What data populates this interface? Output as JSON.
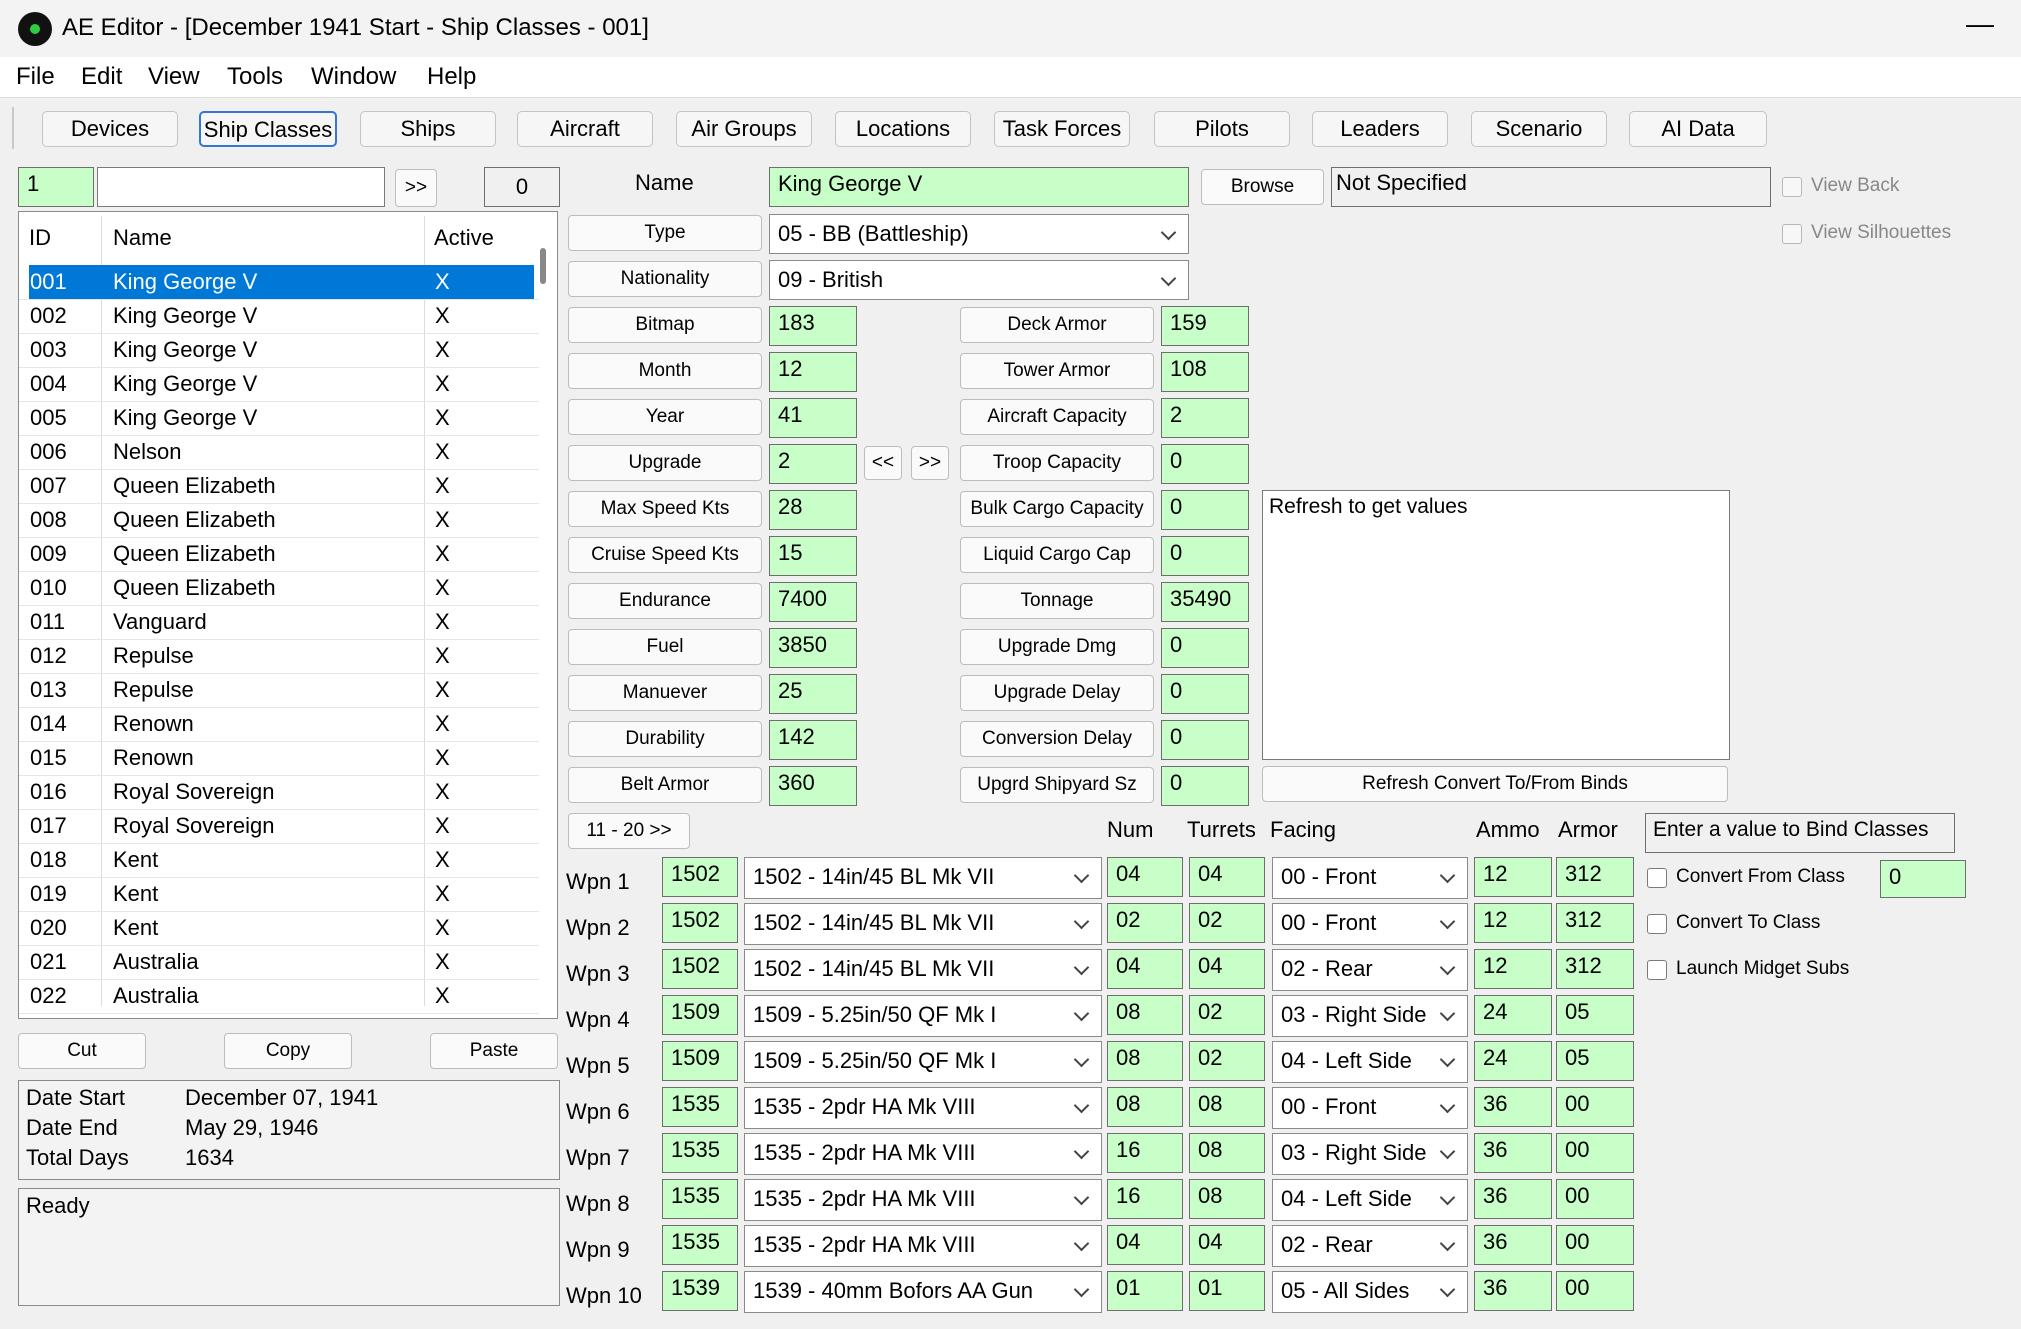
{
  "window": {
    "app": "AE Editor",
    "title": "AE Editor - [December 1941 Start - Ship Classes - 001]"
  },
  "menu": [
    "File",
    "Edit",
    "View",
    "Tools",
    "Window",
    "Help"
  ],
  "tabs": [
    "Devices",
    "Ship Classes",
    "Ships",
    "Aircraft",
    "Air Groups",
    "Locations",
    "Task Forces",
    "Pilots",
    "Leaders",
    "Scenario",
    "AI Data"
  ],
  "active_tab": "Ship Classes",
  "filter": {
    "id_value": "1",
    "search_value": "",
    "go_label": ">>",
    "count": "0"
  },
  "list": {
    "headers": {
      "id": "ID",
      "name": "Name",
      "active": "Active"
    },
    "rows": [
      {
        "id": "001",
        "name": "King George V",
        "active": "X"
      },
      {
        "id": "002",
        "name": "King George V",
        "active": "X"
      },
      {
        "id": "003",
        "name": "King George V",
        "active": "X"
      },
      {
        "id": "004",
        "name": "King George V",
        "active": "X"
      },
      {
        "id": "005",
        "name": "King George V",
        "active": "X"
      },
      {
        "id": "006",
        "name": "Nelson",
        "active": "X"
      },
      {
        "id": "007",
        "name": "Queen Elizabeth",
        "active": "X"
      },
      {
        "id": "008",
        "name": "Queen Elizabeth",
        "active": "X"
      },
      {
        "id": "009",
        "name": "Queen Elizabeth",
        "active": "X"
      },
      {
        "id": "010",
        "name": "Queen Elizabeth",
        "active": "X"
      },
      {
        "id": "011",
        "name": "Vanguard",
        "active": "X"
      },
      {
        "id": "012",
        "name": "Repulse",
        "active": "X"
      },
      {
        "id": "013",
        "name": "Repulse",
        "active": "X"
      },
      {
        "id": "014",
        "name": "Renown",
        "active": "X"
      },
      {
        "id": "015",
        "name": "Renown",
        "active": "X"
      },
      {
        "id": "016",
        "name": "Royal Sovereign",
        "active": "X"
      },
      {
        "id": "017",
        "name": "Royal Sovereign",
        "active": "X"
      },
      {
        "id": "018",
        "name": "Kent",
        "active": "X"
      },
      {
        "id": "019",
        "name": "Kent",
        "active": "X"
      },
      {
        "id": "020",
        "name": "Kent",
        "active": "X"
      },
      {
        "id": "021",
        "name": "Australia",
        "active": "X"
      },
      {
        "id": "022",
        "name": "Australia",
        "active": "X"
      }
    ]
  },
  "clipboard": {
    "cut": "Cut",
    "copy": "Copy",
    "paste": "Paste"
  },
  "dates": {
    "start_label": "Date Start",
    "start_value": "December 07, 1941",
    "end_label": "Date End",
    "end_value": "May 29, 1946",
    "days_label": "Total Days",
    "days_value": "1634"
  },
  "status": "Ready",
  "form": {
    "name_label": "Name",
    "name_value": "King George V",
    "browse_label": "Browse",
    "bitmap_file": "Not Specified",
    "view_back": "View Back",
    "view_silhouettes": "View Silhouettes",
    "type_label": "Type",
    "type_value": "05 - BB (Battleship)",
    "nationality_label": "Nationality",
    "nationality_value": "09 - British",
    "left_fields": [
      {
        "label": "Bitmap",
        "value": "183"
      },
      {
        "label": "Month",
        "value": "12"
      },
      {
        "label": "Year",
        "value": "41"
      },
      {
        "label": "Upgrade",
        "value": "2"
      },
      {
        "label": "Max Speed Kts",
        "value": "28"
      },
      {
        "label": "Cruise Speed Kts",
        "value": "15"
      },
      {
        "label": "Endurance",
        "value": "7400"
      },
      {
        "label": "Fuel",
        "value": "3850"
      },
      {
        "label": "Manuever",
        "value": "25"
      },
      {
        "label": "Durability",
        "value": "142"
      },
      {
        "label": "Belt Armor",
        "value": "360"
      }
    ],
    "upgrade_prev": "<<",
    "upgrade_next": ">>",
    "right_fields": [
      {
        "label": "Deck Armor",
        "value": "159"
      },
      {
        "label": "Tower Armor",
        "value": "108"
      },
      {
        "label": "Aircraft Capacity",
        "value": "2"
      },
      {
        "label": "Troop Capacity",
        "value": "0"
      },
      {
        "label": "Bulk Cargo Capacity",
        "value": "0"
      },
      {
        "label": "Liquid Cargo Cap",
        "value": "0"
      },
      {
        "label": "Tonnage",
        "value": "35490"
      },
      {
        "label": "Upgrade Dmg",
        "value": "0"
      },
      {
        "label": "Upgrade Delay",
        "value": "0"
      },
      {
        "label": "Conversion Delay",
        "value": "0"
      },
      {
        "label": "Upgrd Shipyard Sz",
        "value": "0"
      }
    ],
    "memo_text": "Refresh to get values",
    "refresh_button": "Refresh Convert To/From Binds"
  },
  "weapons": {
    "page_button": "11 - 20 >>",
    "headers": {
      "num": "Num",
      "turrets": "Turrets",
      "facing": "Facing",
      "ammo": "Ammo",
      "armor": "Armor"
    },
    "rows": [
      {
        "label": "Wpn 1",
        "id": "1502",
        "device": "1502 - 14in/45 BL Mk VII",
        "num": "04",
        "turrets": "04",
        "facing": "00 - Front",
        "ammo": "12",
        "armor": "312"
      },
      {
        "label": "Wpn 2",
        "id": "1502",
        "device": "1502 - 14in/45 BL Mk VII",
        "num": "02",
        "turrets": "02",
        "facing": "00 - Front",
        "ammo": "12",
        "armor": "312"
      },
      {
        "label": "Wpn 3",
        "id": "1502",
        "device": "1502 - 14in/45 BL Mk VII",
        "num": "04",
        "turrets": "04",
        "facing": "02 - Rear",
        "ammo": "12",
        "armor": "312"
      },
      {
        "label": "Wpn 4",
        "id": "1509",
        "device": "1509 - 5.25in/50 QF Mk I",
        "num": "08",
        "turrets": "02",
        "facing": "03 - Right Side",
        "ammo": "24",
        "armor": "05"
      },
      {
        "label": "Wpn 5",
        "id": "1509",
        "device": "1509 - 5.25in/50 QF Mk I",
        "num": "08",
        "turrets": "02",
        "facing": "04 - Left Side",
        "ammo": "24",
        "armor": "05"
      },
      {
        "label": "Wpn 6",
        "id": "1535",
        "device": "1535 - 2pdr HA Mk VIII",
        "num": "08",
        "turrets": "08",
        "facing": "00 - Front",
        "ammo": "36",
        "armor": "00"
      },
      {
        "label": "Wpn 7",
        "id": "1535",
        "device": "1535 - 2pdr HA Mk VIII",
        "num": "16",
        "turrets": "08",
        "facing": "03 - Right Side",
        "ammo": "36",
        "armor": "00"
      },
      {
        "label": "Wpn 8",
        "id": "1535",
        "device": "1535 - 2pdr HA Mk VIII",
        "num": "16",
        "turrets": "08",
        "facing": "04 - Left Side",
        "ammo": "36",
        "armor": "00"
      },
      {
        "label": "Wpn 9",
        "id": "1535",
        "device": "1535 - 2pdr HA Mk VIII",
        "num": "04",
        "turrets": "04",
        "facing": "02 - Rear",
        "ammo": "36",
        "armor": "00"
      },
      {
        "label": "Wpn 10",
        "id": "1539",
        "device": "1539 - 40mm Bofors AA Gun",
        "num": "01",
        "turrets": "01",
        "facing": "05 - All Sides",
        "ammo": "36",
        "armor": "00"
      }
    ]
  },
  "bind": {
    "header": "Enter a value to Bind Classes",
    "convert_from": "Convert From Class",
    "convert_from_value": "0",
    "convert_to": "Convert To Class",
    "midget": "Launch Midget Subs"
  }
}
